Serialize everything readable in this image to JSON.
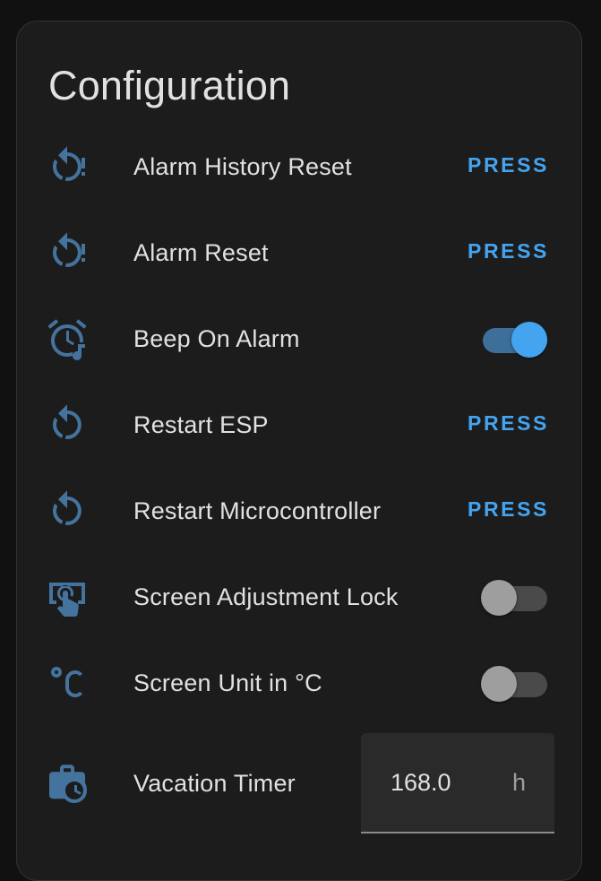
{
  "card": {
    "title": "Configuration"
  },
  "colors": {
    "icon": "#44739e",
    "accent": "#44a4f0",
    "toggle_on_track": "#3d6f9a",
    "toggle_off_thumb": "#9e9e9e",
    "text": "#e1e1e1",
    "card_bg": "#1c1c1c"
  },
  "rows": [
    {
      "label": "Alarm History Reset",
      "icon": "restart-alert-icon",
      "control": "button",
      "button_label": "PRESS"
    },
    {
      "label": "Alarm Reset",
      "icon": "restart-alert-icon",
      "control": "button",
      "button_label": "PRESS"
    },
    {
      "label": "Beep On Alarm",
      "icon": "alarm-note-icon",
      "control": "toggle",
      "state": "on"
    },
    {
      "label": "Restart ESP",
      "icon": "restart-icon",
      "control": "button",
      "button_label": "PRESS"
    },
    {
      "label": "Restart Microcontroller",
      "icon": "restart-icon",
      "control": "button",
      "button_label": "PRESS"
    },
    {
      "label": "Screen Adjustment Lock",
      "icon": "gesture-tap-box-icon",
      "control": "toggle",
      "state": "off"
    },
    {
      "label": "Screen Unit in °C",
      "icon": "temperature-celsius-icon",
      "control": "toggle",
      "state": "off"
    },
    {
      "label": "Vacation Timer",
      "icon": "briefcase-clock-icon",
      "control": "number",
      "value": "168.0",
      "unit": "h"
    }
  ]
}
